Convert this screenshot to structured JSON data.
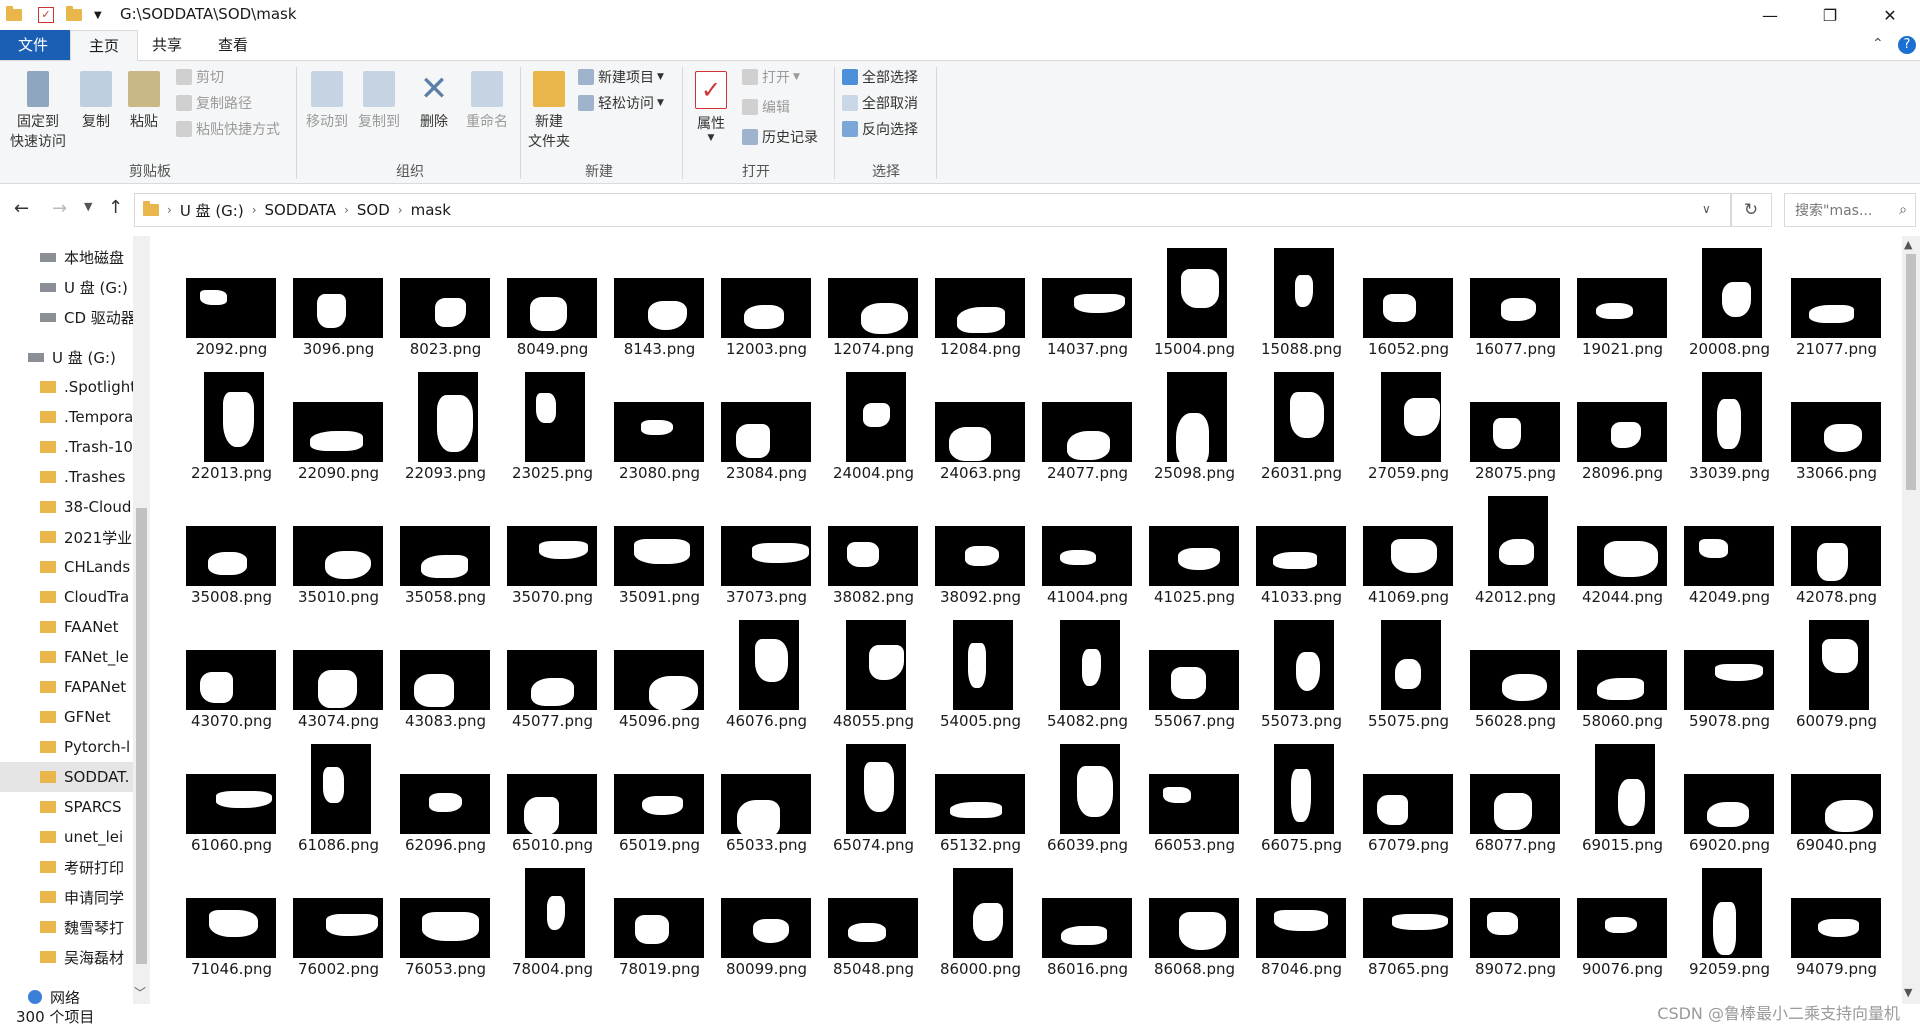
{
  "title_bar": {
    "path": "G:\\SODDATA\\SOD\\mask",
    "min": "—",
    "max": "❐",
    "close": "✕"
  },
  "tabs": [
    "文件",
    "主页",
    "共享",
    "查看"
  ],
  "ribbon": {
    "clipboard": {
      "pin": "固定到快速访问",
      "pin_l1": "固定到",
      "pin_l2": "快速访问",
      "copy": "复制",
      "paste": "粘贴",
      "cut": "剪切",
      "copy_path": "复制路径",
      "paste_shortcut": "粘贴快捷方式",
      "label": "剪贴板"
    },
    "organize": {
      "move_to": "移动到",
      "copy_to": "复制到",
      "delete": "删除",
      "rename": "重命名",
      "label": "组织"
    },
    "new": {
      "new_folder_l1": "新建",
      "new_folder_l2": "文件夹",
      "new_item": "新建项目",
      "easy_access": "轻松访问",
      "label": "新建"
    },
    "open": {
      "properties": "属性",
      "open": "打开",
      "edit": "编辑",
      "history": "历史记录",
      "label": "打开"
    },
    "select": {
      "select_all": "全部选择",
      "select_none": "全部取消",
      "invert": "反向选择",
      "label": "选择"
    }
  },
  "address": {
    "segments": [
      "U 盘 (G:)",
      "SODDATA",
      "SOD",
      "mask"
    ],
    "search_placeholder": "搜索\"mas..."
  },
  "sidebar": [
    {
      "label": "本地磁盘",
      "icon": "drive-icon",
      "indent": 1
    },
    {
      "label": "U 盘 (G:)",
      "icon": "drive-icon",
      "indent": 1
    },
    {
      "label": "CD 驱动器",
      "icon": "cd-icon",
      "indent": 1
    },
    {
      "label": "U 盘 (G:)",
      "icon": "drive-icon",
      "indent": 0
    },
    {
      "label": ".Spotlight",
      "icon": "folder-icon",
      "indent": 1
    },
    {
      "label": ".Temporar",
      "icon": "folder-icon",
      "indent": 1
    },
    {
      "label": ".Trash-10",
      "icon": "folder-icon",
      "indent": 1
    },
    {
      "label": ".Trashes",
      "icon": "folder-icon",
      "indent": 1
    },
    {
      "label": "38-Cloud",
      "icon": "folder-icon",
      "indent": 1
    },
    {
      "label": "2021学业",
      "icon": "folder-icon",
      "indent": 1
    },
    {
      "label": "CHLands",
      "icon": "folder-icon",
      "indent": 1
    },
    {
      "label": "CloudTra",
      "icon": "folder-icon",
      "indent": 1
    },
    {
      "label": "FAANet",
      "icon": "folder-icon",
      "indent": 1
    },
    {
      "label": "FANet_le",
      "icon": "folder-icon",
      "indent": 1
    },
    {
      "label": "FAPANet",
      "icon": "folder-icon",
      "indent": 1
    },
    {
      "label": "GFNet",
      "icon": "folder-icon",
      "indent": 1
    },
    {
      "label": "Pytorch-l",
      "icon": "folder-icon",
      "indent": 1
    },
    {
      "label": "SODDAT.",
      "icon": "folder-icon",
      "indent": 1,
      "selected": true
    },
    {
      "label": "SPARCS",
      "icon": "folder-icon",
      "indent": 1
    },
    {
      "label": "unet_lei",
      "icon": "folder-icon",
      "indent": 1
    },
    {
      "label": "考研打印",
      "icon": "folder-icon",
      "indent": 1
    },
    {
      "label": "申请同学",
      "icon": "folder-icon",
      "indent": 1
    },
    {
      "label": "魏雪琴打",
      "icon": "folder-icon",
      "indent": 1
    },
    {
      "label": "吴海磊材",
      "icon": "folder-icon",
      "indent": 1
    },
    {
      "label": "网络",
      "icon": "network-icon",
      "indent": 0
    }
  ],
  "files": [
    [
      "2092.png",
      "3096.png",
      "8023.png",
      "8049.png",
      "8143.png",
      "12003.png",
      "12074.png",
      "12084.png",
      "14037.png",
      "15004.png",
      "15088.png",
      "16052.png",
      "16077.png",
      "19021.png",
      "20008.png",
      "21077.png"
    ],
    [
      "22013.png",
      "22090.png",
      "22093.png",
      "23025.png",
      "23080.png",
      "23084.png",
      "24004.png",
      "24063.png",
      "24077.png",
      "25098.png",
      "26031.png",
      "27059.png",
      "28075.png",
      "28096.png",
      "33039.png",
      "33066.png"
    ],
    [
      "35008.png",
      "35010.png",
      "35058.png",
      "35070.png",
      "35091.png",
      "37073.png",
      "38082.png",
      "38092.png",
      "41004.png",
      "41025.png",
      "41033.png",
      "41069.png",
      "42012.png",
      "42044.png",
      "42049.png",
      "42078.png"
    ],
    [
      "43070.png",
      "43074.png",
      "43083.png",
      "45077.png",
      "45096.png",
      "46076.png",
      "48055.png",
      "54005.png",
      "54082.png",
      "55067.png",
      "55073.png",
      "55075.png",
      "56028.png",
      "58060.png",
      "59078.png",
      "60079.png"
    ],
    [
      "61060.png",
      "61086.png",
      "62096.png",
      "65010.png",
      "65019.png",
      "65033.png",
      "65074.png",
      "65132.png",
      "66039.png",
      "66053.png",
      "66075.png",
      "67079.png",
      "68077.png",
      "69015.png",
      "69020.png",
      "69040.png"
    ],
    [
      "71046.png",
      "76002.png",
      "76053.png",
      "78004.png",
      "78019.png",
      "80099.png",
      "85048.png",
      "86000.png",
      "86016.png",
      "86068.png",
      "87046.png",
      "87065.png",
      "89072.png",
      "90076.png",
      "92059.png",
      "94079.png"
    ]
  ],
  "status": {
    "count": "300 个项目"
  },
  "watermark": "CSDN @鲁棒最小二乘支持向量机"
}
